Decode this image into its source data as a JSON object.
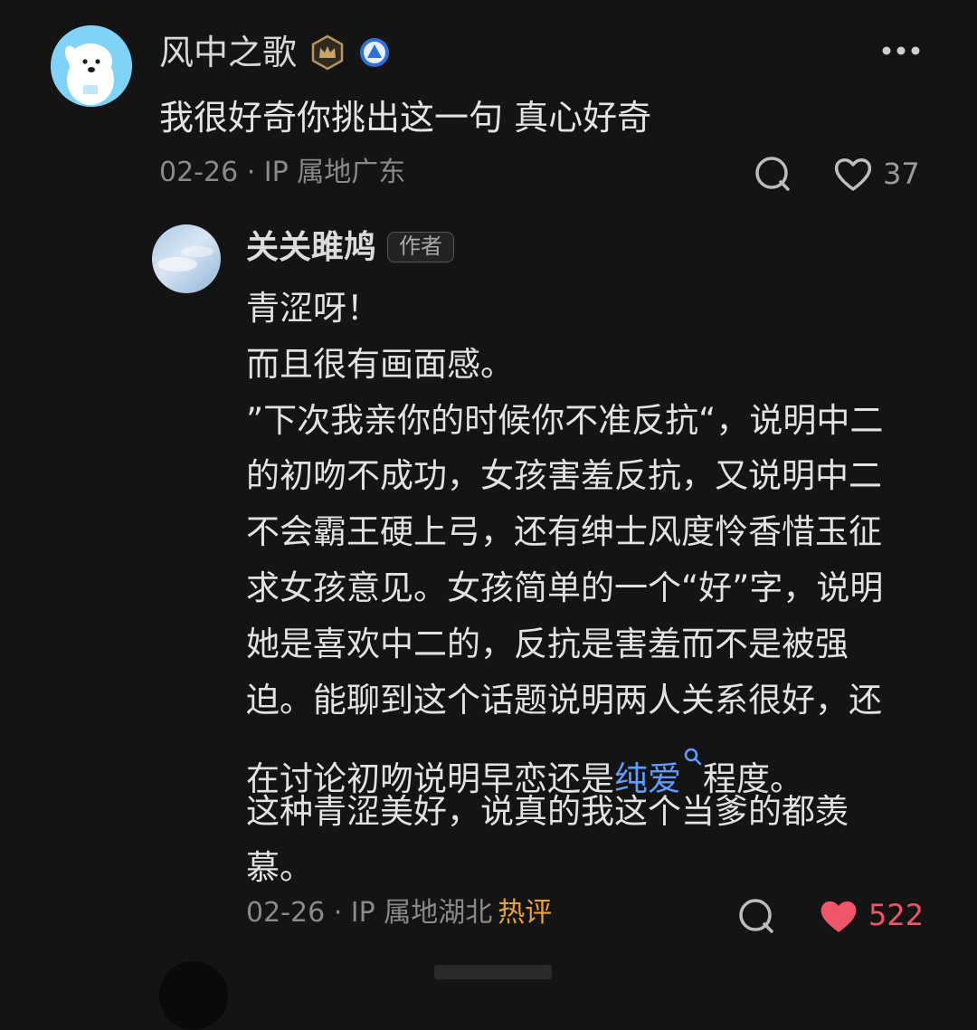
{
  "comment": {
    "username": "风中之歌",
    "text": "我很好奇你挑出这一句 真心好奇",
    "meta": "02-26 · IP 属地广东",
    "like_count": "37"
  },
  "reply": {
    "username": "关关雎鸠",
    "author_tag": "作者",
    "lines": [
      "青涩呀！",
      "而且很有画面感。",
      "”下次我亲你的时候你不准反抗“，说明中二",
      "的初吻不成功，女孩害羞反抗，又说明中二",
      "不会霸王硬上弓，还有绅士风度怜香惜玉征",
      "求女孩意见。女孩简单的一个“好”字，说明",
      "她是喜欢中二的，反抗是害羞而不是被强",
      "迫。能聊到这个话题说明两人关系很好，还"
    ],
    "line_with_link_before": "在讨论初吻说明早恋还是",
    "search_link": "纯爱",
    "line_with_link_after": "程度。",
    "lines_end": [
      "这种青涩美好，说真的我这个当爹的都羡",
      "慕。"
    ],
    "meta": "02-26 · IP 属地湖北",
    "hot_tag": "热评",
    "like_count": "522"
  },
  "colors": {
    "background": "#141414",
    "link": "#5f9cff",
    "hot": "#e6a23c",
    "liked": "#f0566a"
  },
  "icons": [
    "more-icon",
    "crown-badge-icon",
    "level-badge-icon",
    "reply-bubble-icon",
    "heart-icon",
    "heart-filled-icon",
    "search-icon"
  ]
}
